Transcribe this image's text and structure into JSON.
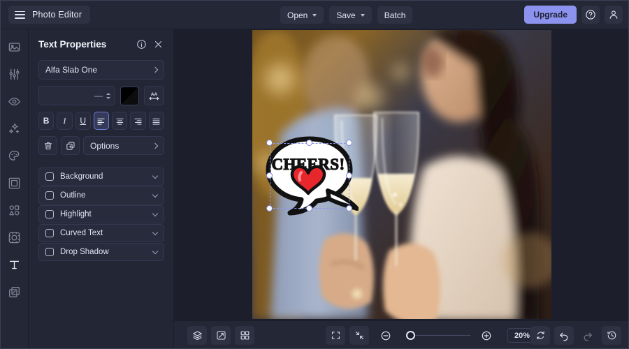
{
  "app": {
    "title": "Photo Editor",
    "accent": "#8c93ee",
    "panel_bg": "#232635",
    "canvas_bg": "#1c1f2b"
  },
  "topbar": {
    "menu_icon": "hamburger-icon",
    "open_label": "Open",
    "save_label": "Save",
    "batch_label": "Batch",
    "upgrade_label": "Upgrade",
    "help_icon": "help-circle-icon",
    "account_icon": "user-icon"
  },
  "rail": {
    "items": [
      {
        "name": "image",
        "icon": "image-icon",
        "active": false
      },
      {
        "name": "adjust",
        "icon": "sliders-icon",
        "active": false
      },
      {
        "name": "retouch",
        "icon": "eye-icon",
        "active": false
      },
      {
        "name": "effects",
        "icon": "sparkles-icon",
        "active": false
      },
      {
        "name": "color",
        "icon": "palette-icon",
        "active": false
      },
      {
        "name": "frames",
        "icon": "frame-icon",
        "active": false
      },
      {
        "name": "elements",
        "icon": "shapes-icon",
        "active": false
      },
      {
        "name": "overlays",
        "icon": "overlay-icon",
        "active": false
      },
      {
        "name": "text",
        "icon": "text-t-icon",
        "active": true
      },
      {
        "name": "layers",
        "icon": "layers-duplicate-icon",
        "active": false
      }
    ]
  },
  "panel": {
    "title": "Text Properties",
    "info_icon": "info-circle-icon",
    "close_icon": "close-x-icon",
    "font_family": "Alfa Slab One",
    "font_size": "—",
    "text_color": "#000000",
    "letter_spacing_icon": "letter-spacing-icon",
    "format": {
      "bold": "B",
      "italic": "I",
      "underline": "U",
      "align_left_active": true
    },
    "delete_icon": "trash-icon",
    "duplicate_icon": "duplicate-icon",
    "options_label": "Options",
    "toggles": [
      {
        "label": "Background",
        "checked": false
      },
      {
        "label": "Outline",
        "checked": false
      },
      {
        "label": "Highlight",
        "checked": false
      },
      {
        "label": "Curved Text",
        "checked": false
      },
      {
        "label": "Drop Shadow",
        "checked": false
      }
    ]
  },
  "canvas": {
    "sticker_text": "CHEERS!",
    "sticker_shape": "speech-bubble-with-heart",
    "selected": true
  },
  "bottombar": {
    "layers_icon": "layers-icon",
    "compare_icon": "compare-icon",
    "grid_icon": "grid-icon",
    "fit_icon": "fit-screen-icon",
    "shrink_icon": "shrink-icon",
    "zoom_out_icon": "zoom-out-icon",
    "zoom_in_icon": "zoom-in-icon",
    "zoom_value": "20%",
    "reset_icon": "reset-icon",
    "undo_icon": "undo-icon",
    "redo_icon": "redo-icon",
    "history_icon": "history-icon"
  }
}
